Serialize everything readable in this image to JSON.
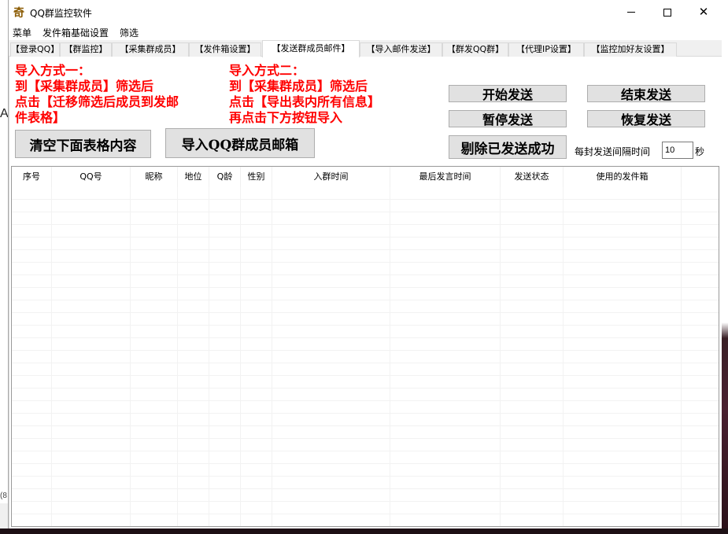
{
  "window": {
    "app_icon_glyph": "奇",
    "title": "QQ群监控软件",
    "controls": {
      "minimize": "minimize",
      "maximize": "maximize",
      "close": "✕"
    }
  },
  "menu": [
    "菜单",
    "发件箱基础设置",
    "筛选"
  ],
  "tabs": [
    {
      "label": "【登录QQ】",
      "active": false
    },
    {
      "label": "【群监控】",
      "active": false
    },
    {
      "label": "【采集群成员】",
      "active": false
    },
    {
      "label": "【发件箱设置】",
      "active": false
    },
    {
      "label": "【发送群成员邮件】",
      "active": true
    },
    {
      "label": "【导入邮件发送】",
      "active": false
    },
    {
      "label": "【群发QQ群】",
      "active": false
    },
    {
      "label": "【代理IP设置】",
      "active": false
    },
    {
      "label": "【监控加好友设置】",
      "active": false
    }
  ],
  "instructions": {
    "method1": [
      "导入方式一：",
      "到【采集群成员】筛选后",
      "点击【迁移筛选后成员到发邮",
      "件表格】"
    ],
    "method2": [
      "导入方式二：",
      "到【采集群成员】筛选后",
      "点击【导出表内所有信息】",
      "再点击下方按钮导入"
    ]
  },
  "buttons": {
    "clear_table": "清空下面表格内容",
    "import_emails": "导入QQ群成员邮箱",
    "start_send": "开始发送",
    "end_send": "结束发送",
    "pause_send": "暂停发送",
    "resume_send": "恢复发送",
    "remove_sent": "剔除已发送成功"
  },
  "interval": {
    "label": "每封发送间隔时间",
    "value": "10",
    "unit": "秒"
  },
  "table": {
    "columns": [
      "序号",
      "QQ号",
      "昵称",
      "地位",
      "Q龄",
      "性别",
      "入群时间",
      "最后发言时间",
      "发送状态",
      "使用的发件箱"
    ],
    "rows": []
  },
  "background": {
    "left_glyph": "A",
    "left_glyph2": "(8"
  },
  "colors": {
    "instruction_text": "#ff0000",
    "button_bg": "#e1e1e1",
    "window_bg": "#f0f0f0"
  }
}
